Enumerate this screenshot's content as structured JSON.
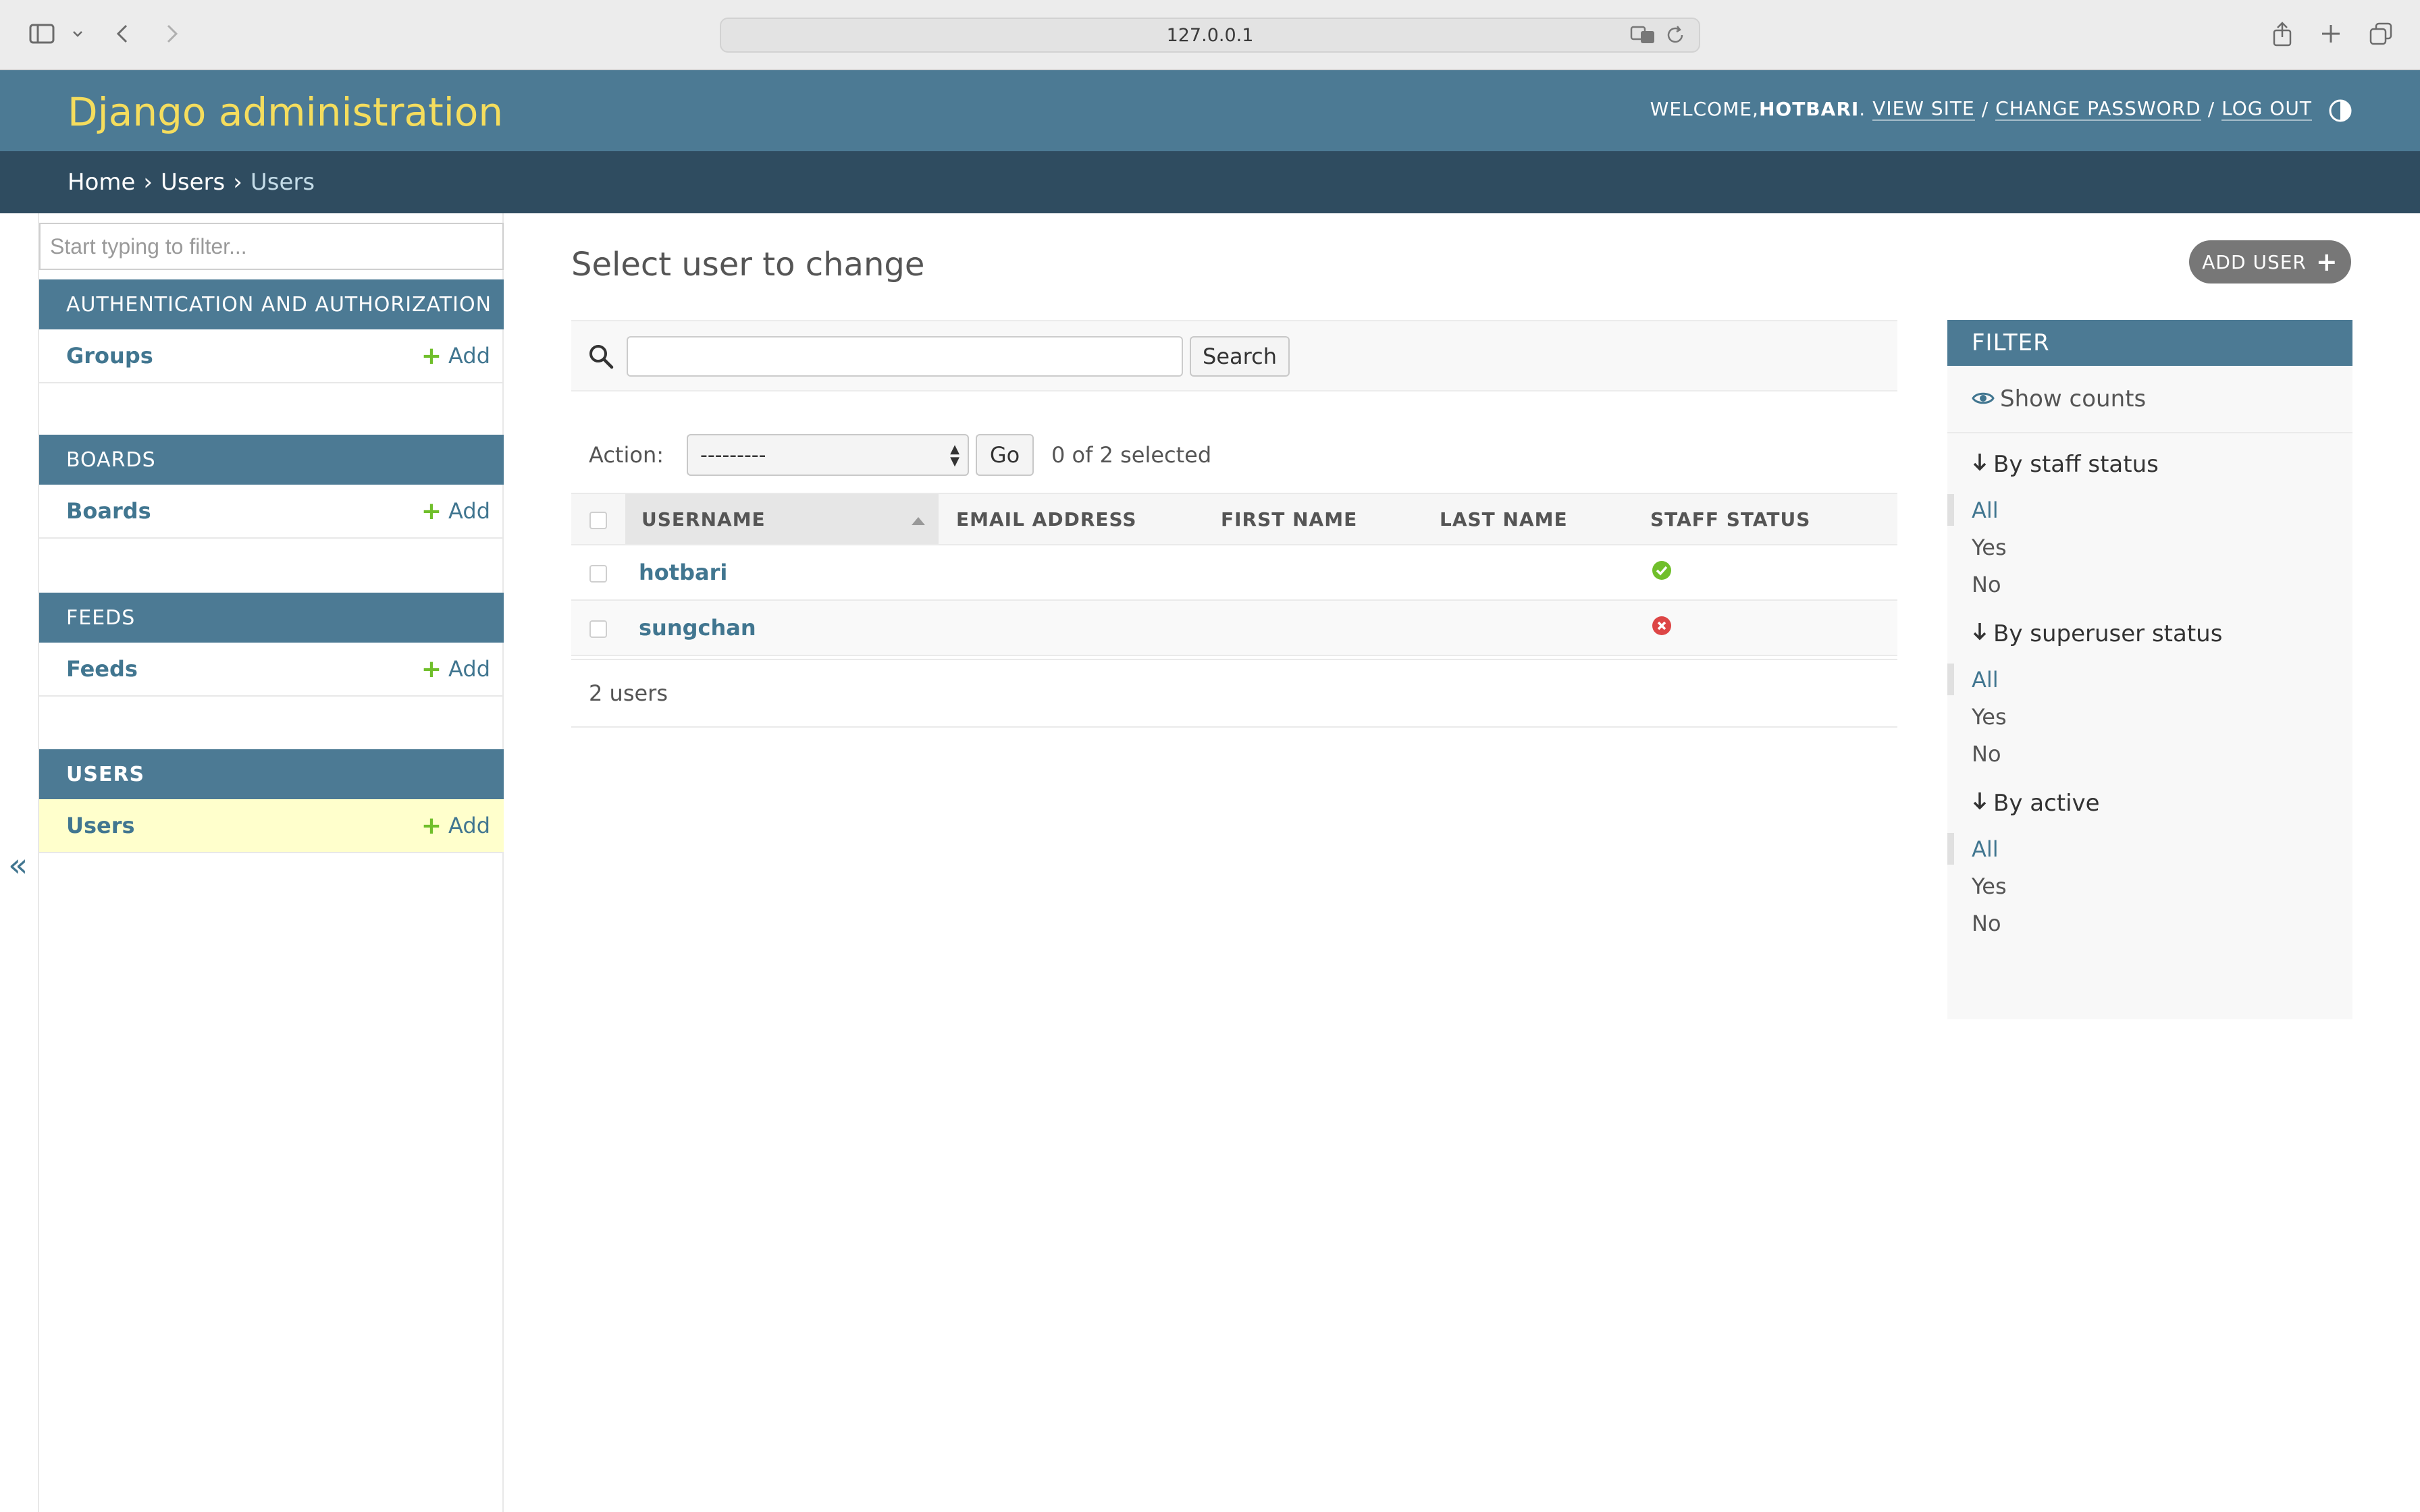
{
  "browser": {
    "url": "127.0.0.1"
  },
  "header": {
    "branding": "Django administration",
    "welcome": "WELCOME, ",
    "username": "HOTBARI",
    "period": ".",
    "view_site": "VIEW SITE",
    "change_password": "CHANGE PASSWORD",
    "log_out": "LOG OUT",
    "separator": "/"
  },
  "breadcrumbs": {
    "home": "Home",
    "app": "Users",
    "current": "Users",
    "sep": "›"
  },
  "sidebar": {
    "filter_placeholder": "Start typing to filter...",
    "collapse": "«",
    "add_label": "Add",
    "modules": [
      {
        "caption": "AUTHENTICATION AND AUTHORIZATION",
        "model": "Groups"
      },
      {
        "caption": "BOARDS",
        "model": "Boards"
      },
      {
        "caption": "FEEDS",
        "model": "Feeds"
      },
      {
        "caption": "USERS",
        "model": "Users"
      }
    ]
  },
  "content": {
    "title": "Select user to change",
    "add_user": "ADD USER",
    "search_button": "Search",
    "action_label": "Action:",
    "action_selected": "---------",
    "go_button": "Go",
    "action_counter": "0 of 2 selected",
    "columns": [
      "USERNAME",
      "EMAIL ADDRESS",
      "FIRST NAME",
      "LAST NAME",
      "STAFF STATUS"
    ],
    "rows": [
      {
        "username": "hotbari",
        "staff": true
      },
      {
        "username": "sungchan",
        "staff": false
      }
    ],
    "paginator": "2 users"
  },
  "filter": {
    "title": "FILTER",
    "show_counts": "Show counts",
    "groups": [
      {
        "title": "By staff status",
        "options": [
          "All",
          "Yes",
          "No"
        ]
      },
      {
        "title": "By superuser status",
        "options": [
          "All",
          "Yes",
          "No"
        ]
      },
      {
        "title": "By active",
        "options": [
          "All",
          "Yes",
          "No"
        ]
      }
    ]
  },
  "colors": {
    "header_bg": "#4c7a94",
    "breadcrumb_bg": "#2f4c60",
    "brand_yellow": "#f5dd5d",
    "link": "#417690",
    "add_green": "#70bf2b",
    "staff_yes": "#70bf2b",
    "staff_no": "#dd4646",
    "current_row": "#ffffcc"
  }
}
